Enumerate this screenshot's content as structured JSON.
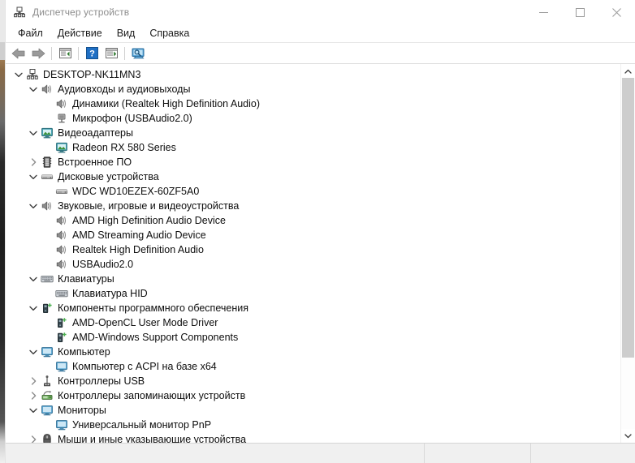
{
  "window": {
    "title": "Диспетчер устройств",
    "icon": "device-manager-icon",
    "minimize_label": "—",
    "maximize_label": "□",
    "close_label": "✕"
  },
  "menubar": {
    "items": [
      {
        "label": "Файл",
        "name": "menu-file"
      },
      {
        "label": "Действие",
        "name": "menu-action"
      },
      {
        "label": "Вид",
        "name": "menu-view"
      },
      {
        "label": "Справка",
        "name": "menu-help"
      }
    ]
  },
  "toolbar": {
    "buttons": [
      {
        "name": "back-button",
        "icon": "arrow-left-icon",
        "label": "Назад"
      },
      {
        "name": "forward-button",
        "icon": "arrow-right-icon",
        "label": "Вперед"
      },
      {
        "name": "properties-button",
        "icon": "properties-icon",
        "label": "Свойства"
      },
      {
        "name": "help-button",
        "icon": "help-question-icon",
        "label": "Справка"
      },
      {
        "name": "update-driver-button",
        "icon": "update-driver-icon",
        "label": "Обновить драйвер"
      },
      {
        "name": "scan-hardware-button",
        "icon": "scan-monitor-icon",
        "label": "Обновить конфигурацию оборудования"
      }
    ]
  },
  "tree": {
    "rows": [
      {
        "level": 0,
        "state": "expanded",
        "icon": "computer-network-icon",
        "label": "DESKTOP-NK11MN3"
      },
      {
        "level": 1,
        "state": "expanded",
        "icon": "speaker-icon",
        "label": "Аудиовходы и аудиовыходы"
      },
      {
        "level": 2,
        "state": "leaf",
        "icon": "speaker-icon",
        "label": "Динамики (Realtek High Definition Audio)"
      },
      {
        "level": 2,
        "state": "leaf",
        "icon": "microphone-icon",
        "label": "Микрофон (USBAudio2.0)"
      },
      {
        "level": 1,
        "state": "expanded",
        "icon": "display-adapter-icon",
        "label": "Видеоадаптеры"
      },
      {
        "level": 2,
        "state": "leaf",
        "icon": "display-adapter-icon",
        "label": "Radeon RX 580 Series"
      },
      {
        "level": 1,
        "state": "collapsed",
        "icon": "firmware-icon",
        "label": "Встроенное ПО"
      },
      {
        "level": 1,
        "state": "expanded",
        "icon": "disk-drive-icon",
        "label": "Дисковые устройства"
      },
      {
        "level": 2,
        "state": "leaf",
        "icon": "disk-drive-icon",
        "label": "WDC WD10EZEX-60ZF5A0"
      },
      {
        "level": 1,
        "state": "expanded",
        "icon": "speaker-icon",
        "label": "Звуковые, игровые и видеоустройства"
      },
      {
        "level": 2,
        "state": "leaf",
        "icon": "speaker-icon",
        "label": "AMD High Definition Audio Device"
      },
      {
        "level": 2,
        "state": "leaf",
        "icon": "speaker-icon",
        "label": "AMD Streaming Audio Device"
      },
      {
        "level": 2,
        "state": "leaf",
        "icon": "speaker-icon",
        "label": "Realtek High Definition Audio"
      },
      {
        "level": 2,
        "state": "leaf",
        "icon": "speaker-icon",
        "label": "USBAudio2.0"
      },
      {
        "level": 1,
        "state": "expanded",
        "icon": "keyboard-icon",
        "label": "Клавиатуры"
      },
      {
        "level": 2,
        "state": "leaf",
        "icon": "keyboard-icon",
        "label": "Клавиатура HID"
      },
      {
        "level": 1,
        "state": "expanded",
        "icon": "software-component-icon",
        "label": "Компоненты программного обеспечения"
      },
      {
        "level": 2,
        "state": "leaf",
        "icon": "software-component-icon",
        "label": "AMD-OpenCL User Mode Driver"
      },
      {
        "level": 2,
        "state": "leaf",
        "icon": "software-component-icon",
        "label": "AMD-Windows Support Components"
      },
      {
        "level": 1,
        "state": "expanded",
        "icon": "monitor-icon",
        "label": "Компьютер"
      },
      {
        "level": 2,
        "state": "leaf",
        "icon": "monitor-icon",
        "label": "Компьютер с ACPI на базе x64"
      },
      {
        "level": 1,
        "state": "collapsed",
        "icon": "usb-icon",
        "label": "Контроллеры USB"
      },
      {
        "level": 1,
        "state": "collapsed",
        "icon": "storage-controller-icon",
        "label": "Контроллеры запоминающих устройств"
      },
      {
        "level": 1,
        "state": "expanded",
        "icon": "monitor-icon",
        "label": "Мониторы"
      },
      {
        "level": 2,
        "state": "leaf",
        "icon": "monitor-icon",
        "label": "Универсальный монитор PnP"
      },
      {
        "level": 1,
        "state": "collapsed",
        "icon": "mouse-icon",
        "label": "Мыши и иные указывающие устройства"
      }
    ]
  },
  "scrollbar": {
    "up_arrow": "chevron-up-icon",
    "down_arrow": "chevron-down-icon"
  },
  "statusbar": {
    "cells": [
      "",
      "",
      ""
    ]
  }
}
